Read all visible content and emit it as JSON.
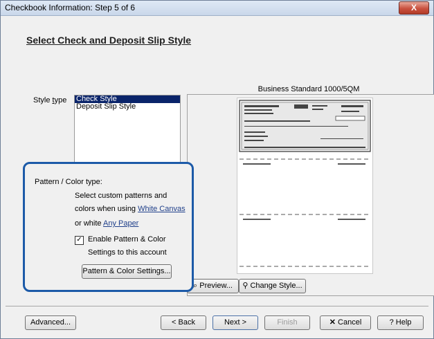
{
  "window": {
    "title": "Checkbook Information: Step 5 of 6",
    "close_label": "X"
  },
  "page": {
    "heading": "Select Check and Deposit Slip Style"
  },
  "style": {
    "label": "Style type",
    "items": [
      "Check Style",
      "Deposit Slip Style"
    ],
    "selected": "Check Style"
  },
  "preview": {
    "title": "Business Standard 1000/5QM",
    "preview_button": "Preview...",
    "change_style_button": "Change Style..."
  },
  "pattern": {
    "title": "Pattern / Color type:",
    "line1": "Select custom patterns and",
    "line2_prefix": "colors when using",
    "line2_link": "White Canvas",
    "line3_prefix": "or white",
    "line3_link": "Any Paper",
    "enable_label": "Enable Pattern & Color",
    "enable_label2": "Settings to this account",
    "checkbox_checked": "true",
    "settings_button": "Pattern & Color Settings..."
  },
  "footer": {
    "advanced": "Advanced...",
    "back": "< Back",
    "next": "Next >",
    "finish": "Finish",
    "cancel": "Cancel",
    "help": "Help"
  },
  "colors": {
    "selection": "#0a246a",
    "highlight_border": "#1c5aa8"
  }
}
